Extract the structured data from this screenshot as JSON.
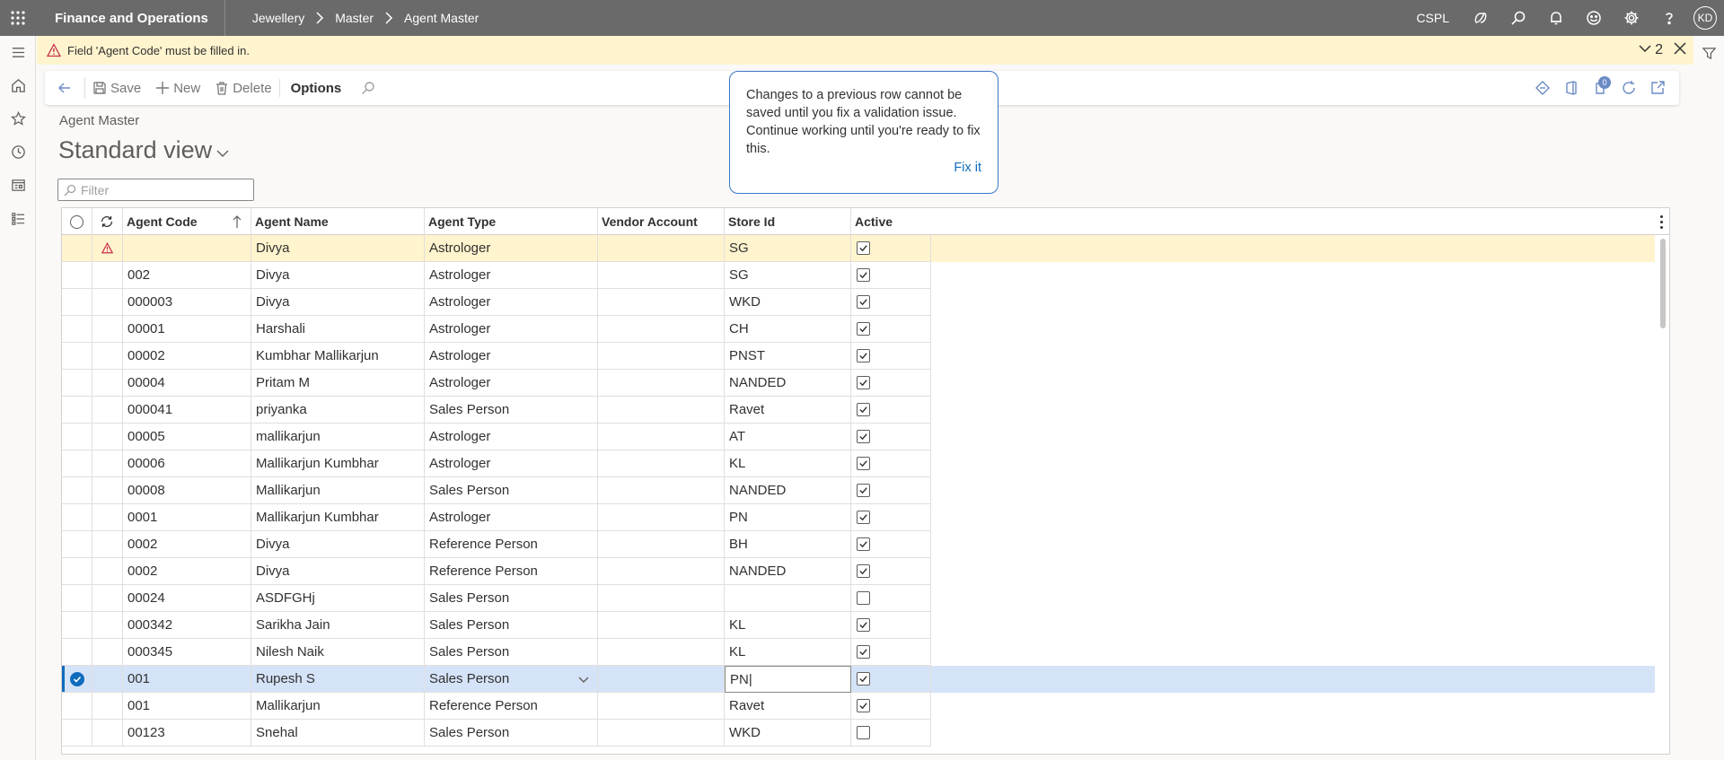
{
  "app": {
    "title": "Finance and Operations",
    "breadcrumbs": [
      "Jewellery",
      "Master",
      "Agent Master"
    ],
    "company": "CSPL",
    "user_initials": "KD"
  },
  "message_bar": {
    "text": "Field 'Agent Code' must be filled in.",
    "count": "2"
  },
  "action_pane": {
    "save_label": "Save",
    "new_label": "New",
    "delete_label": "Delete",
    "options_label": "Options",
    "notification_badge": "0"
  },
  "popover": {
    "text": "Changes to a previous row cannot be saved until you fix a validation issue. Continue working until you're ready to fix this.",
    "fix_label": "Fix it"
  },
  "page": {
    "caption": "Agent Master",
    "view_name": "Standard view",
    "filter_placeholder": "Filter"
  },
  "grid": {
    "columns": [
      "Agent Code",
      "Agent Name",
      "Agent Type",
      "Vendor Account",
      "Store Id",
      "Active"
    ],
    "rows": [
      {
        "code": "",
        "name": "Divya",
        "type": "Astrologer",
        "vendor": "",
        "store": "SG",
        "active": true,
        "state": "warning"
      },
      {
        "code": "002",
        "name": "Divya",
        "type": "Astrologer",
        "vendor": "",
        "store": "SG",
        "active": true,
        "state": ""
      },
      {
        "code": "000003",
        "name": "Divya",
        "type": "Astrologer",
        "vendor": "",
        "store": "WKD",
        "active": true,
        "state": ""
      },
      {
        "code": "00001",
        "name": "Harshali",
        "type": "Astrologer",
        "vendor": "",
        "store": "CH",
        "active": true,
        "state": ""
      },
      {
        "code": "00002",
        "name": "Kumbhar Mallikarjun",
        "type": "Astrologer",
        "vendor": "",
        "store": "PNST",
        "active": true,
        "state": ""
      },
      {
        "code": "00004",
        "name": "Pritam M",
        "type": "Astrologer",
        "vendor": "",
        "store": "NANDED",
        "active": true,
        "state": ""
      },
      {
        "code": "000041",
        "name": "priyanka",
        "type": "Sales Person",
        "vendor": "",
        "store": "Ravet",
        "active": true,
        "state": ""
      },
      {
        "code": "00005",
        "name": "mallikarjun",
        "type": "Astrologer",
        "vendor": "",
        "store": "AT",
        "active": true,
        "state": ""
      },
      {
        "code": "00006",
        "name": "Mallikarjun Kumbhar",
        "type": "Astrologer",
        "vendor": "",
        "store": "KL",
        "active": true,
        "state": ""
      },
      {
        "code": "00008",
        "name": "Mallikarjun",
        "type": "Sales Person",
        "vendor": "",
        "store": "NANDED",
        "active": true,
        "state": ""
      },
      {
        "code": "0001",
        "name": "Mallikarjun Kumbhar",
        "type": "Astrologer",
        "vendor": "",
        "store": "PN",
        "active": true,
        "state": ""
      },
      {
        "code": "0002",
        "name": "Divya",
        "type": "Reference Person",
        "vendor": "",
        "store": "BH",
        "active": true,
        "state": ""
      },
      {
        "code": "0002",
        "name": "Divya",
        "type": "Reference Person",
        "vendor": "",
        "store": "NANDED",
        "active": true,
        "state": ""
      },
      {
        "code": "00024",
        "name": "ASDFGHj",
        "type": "Sales Person",
        "vendor": "",
        "store": "",
        "active": false,
        "state": ""
      },
      {
        "code": "000342",
        "name": "Sarikha Jain",
        "type": "Sales Person",
        "vendor": "",
        "store": "KL",
        "active": true,
        "state": ""
      },
      {
        "code": "000345",
        "name": "Nilesh Naik",
        "type": "Sales Person",
        "vendor": "",
        "store": "KL",
        "active": true,
        "state": ""
      },
      {
        "code": "001",
        "name": "Rupesh S",
        "type": "Sales Person",
        "vendor": "",
        "store": "PN",
        "active": true,
        "state": "selected"
      },
      {
        "code": "001",
        "name": "Mallikarjun",
        "type": "Reference Person",
        "vendor": "",
        "store": "Ravet",
        "active": true,
        "state": ""
      },
      {
        "code": "00123",
        "name": "Snehal",
        "type": "Sales Person",
        "vendor": "",
        "store": "WKD",
        "active": false,
        "state": ""
      }
    ]
  },
  "colors": {
    "topbar": "#6a6a6a",
    "warning_bg": "#fff4ce",
    "selected_row": "#d5e3f8",
    "accent": "#0f6cbd"
  }
}
